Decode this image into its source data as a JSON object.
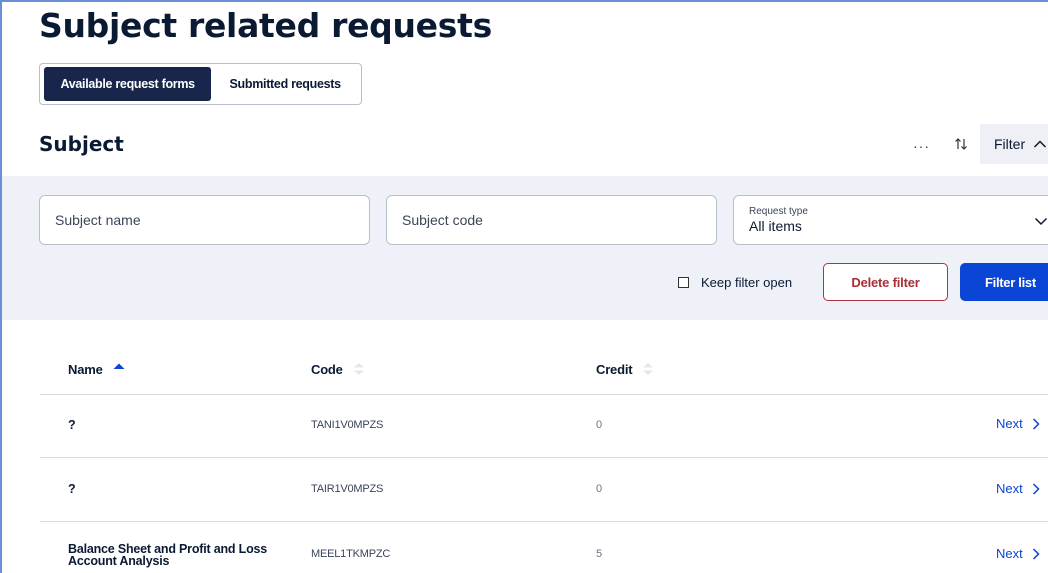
{
  "page": {
    "title": "Subject related requests"
  },
  "tabs": [
    {
      "label": "Available request forms",
      "active": true
    },
    {
      "label": "Submitted requests",
      "active": false
    }
  ],
  "section": {
    "title": "Subject",
    "more_icon": "more-icon",
    "sort_icon": "sort-icon",
    "filter_label": "Filter"
  },
  "filters": {
    "subject_name_placeholder": "Subject name",
    "subject_code_placeholder": "Subject code",
    "request_type": {
      "label": "Request type",
      "value": "All items"
    },
    "keep_open_label": "Keep filter open",
    "keep_open_checked": false,
    "delete_label": "Delete filter",
    "apply_label": "Filter list"
  },
  "table": {
    "columns": [
      {
        "label": "Name",
        "sort": "asc"
      },
      {
        "label": "Code",
        "sort": "none"
      },
      {
        "label": "Credit",
        "sort": "none"
      }
    ],
    "rows": [
      {
        "name": "?",
        "code": "TANI1V0MPZS",
        "credit": "0",
        "action": "Next"
      },
      {
        "name": "?",
        "code": "TAIR1V0MPZS",
        "credit": "0",
        "action": "Next"
      },
      {
        "name": "Balance Sheet and Profit and Loss Account Analysis",
        "code": "MEEL1TKMPZC",
        "credit": "5",
        "action": "Next"
      }
    ]
  },
  "colors": {
    "primary_dark": "#17264a",
    "primary_blue": "#0a45d6",
    "danger": "#a82f35",
    "panel_bg": "#eff1f8"
  }
}
